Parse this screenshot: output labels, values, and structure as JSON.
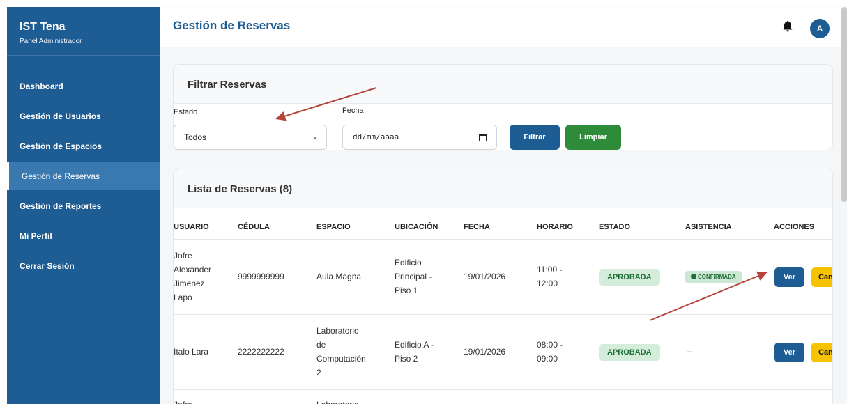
{
  "sidebar": {
    "brand_title": "IST Tena",
    "brand_subtitle": "Panel Administrador",
    "items": [
      {
        "label": "Dashboard"
      },
      {
        "label": "Gestión de Usuarios"
      },
      {
        "label": "Gestión de Espacios"
      },
      {
        "label": "Gestión de Reservas",
        "active": true
      },
      {
        "label": "Gestión de Reportes"
      },
      {
        "label": "Mi Perfil"
      },
      {
        "label": "Cerrar Sesión"
      }
    ]
  },
  "header": {
    "title": "Gestión de Reservas",
    "avatar_initial": "A",
    "bell_icon": "bell-icon"
  },
  "filter": {
    "title": "Filtrar Reservas",
    "estado_label": "Estado",
    "estado_value": "Todos",
    "fecha_label": "Fecha",
    "fecha_placeholder": "dd/mm/aaaa",
    "filtrar_label": "Filtrar",
    "limpiar_label": "Limpiar"
  },
  "list": {
    "title": "Lista de Reservas (8)",
    "columns": [
      "USUARIO",
      "CÉDULA",
      "ESPACIO",
      "UBICACIÓN",
      "FECHA",
      "HORARIO",
      "ESTADO",
      "ASISTENCIA",
      "ACCIONES"
    ],
    "rows": [
      {
        "usuario": [
          "Jofre",
          "Alexander",
          "Jimenez",
          "Lapo"
        ],
        "cedula": "9999999999",
        "espacio": [
          "Aula Magna"
        ],
        "ubicacion": [
          "Edificio",
          "Principal -",
          "Piso 1"
        ],
        "fecha": "19/01/2026",
        "horario": [
          "11:00 -",
          "12:00"
        ],
        "estado": "APROBADA",
        "asistencia": "CONFIRMADA",
        "ver": "Ver",
        "cancelar": "Can"
      },
      {
        "usuario": [
          "Italo Lara"
        ],
        "cedula": "2222222222",
        "espacio": [
          "Laboratorio",
          "de",
          "Computación",
          "2"
        ],
        "ubicacion": [
          "Edificio A -",
          "Piso 2"
        ],
        "fecha": "19/01/2026",
        "horario": [
          "08:00 -",
          "09:00"
        ],
        "estado": "APROBADA",
        "asistencia": "–",
        "ver": "Ver",
        "cancelar": "Can"
      },
      {
        "usuario": [
          "Jofre"
        ],
        "espacio": [
          "Laboratorio"
        ]
      }
    ]
  },
  "colors": {
    "primary": "#1e5c94",
    "success": "#2e8b3a",
    "warning": "#f7c300",
    "annotation_arrow": "#b5453c"
  }
}
